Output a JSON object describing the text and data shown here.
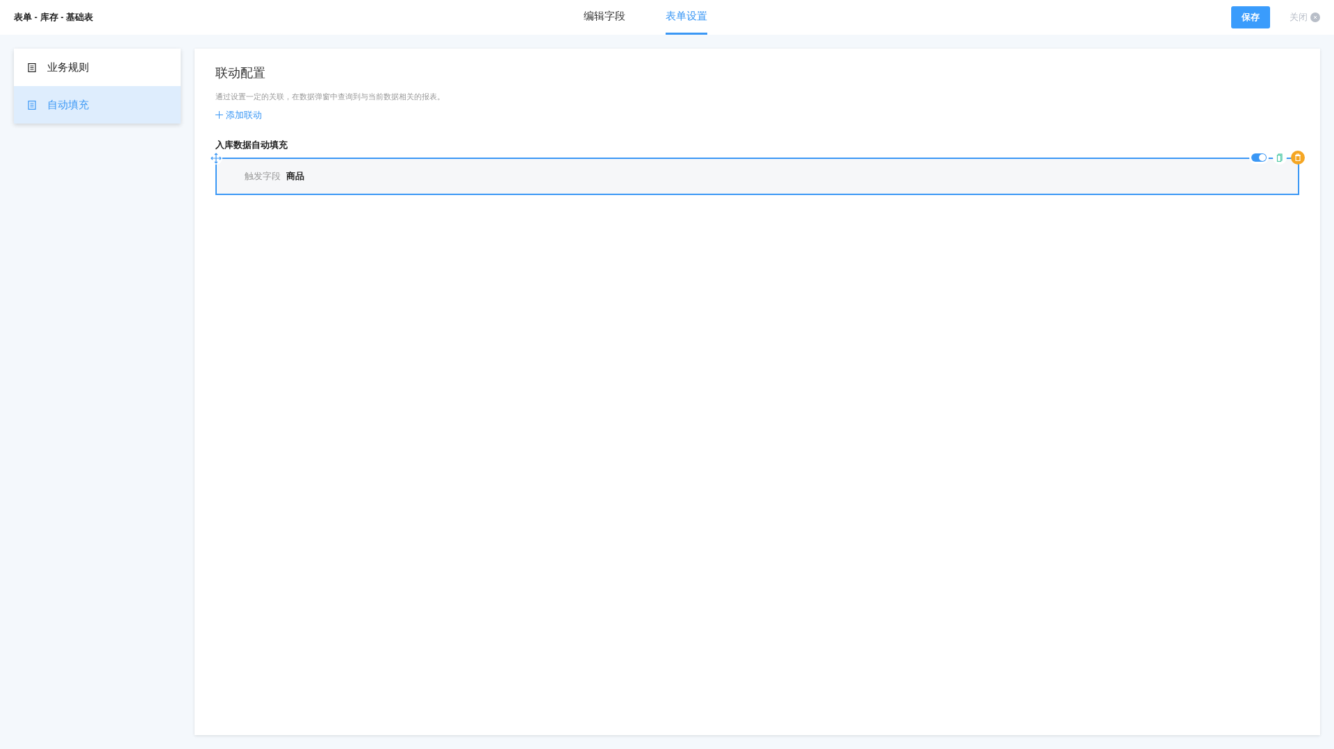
{
  "header": {
    "title": "表单 - 库存 - 基础表",
    "tabs": [
      {
        "label": "编辑字段",
        "selected": false
      },
      {
        "label": "表单设置",
        "selected": true
      }
    ],
    "save": "保存",
    "close": "关闭"
  },
  "sidebar": {
    "items": [
      {
        "label": "业务规则",
        "selected": false
      },
      {
        "label": "自动填充",
        "selected": true
      }
    ]
  },
  "main": {
    "title": "联动配置",
    "description": "通过设置一定的关联，在数据弹窗中查询到与当前数据相关的报表。",
    "add": "添加联动",
    "rules": [
      {
        "name": "入库数据自动填充",
        "enabled": true,
        "field_label": "触发字段",
        "field_value": "商品"
      }
    ]
  }
}
